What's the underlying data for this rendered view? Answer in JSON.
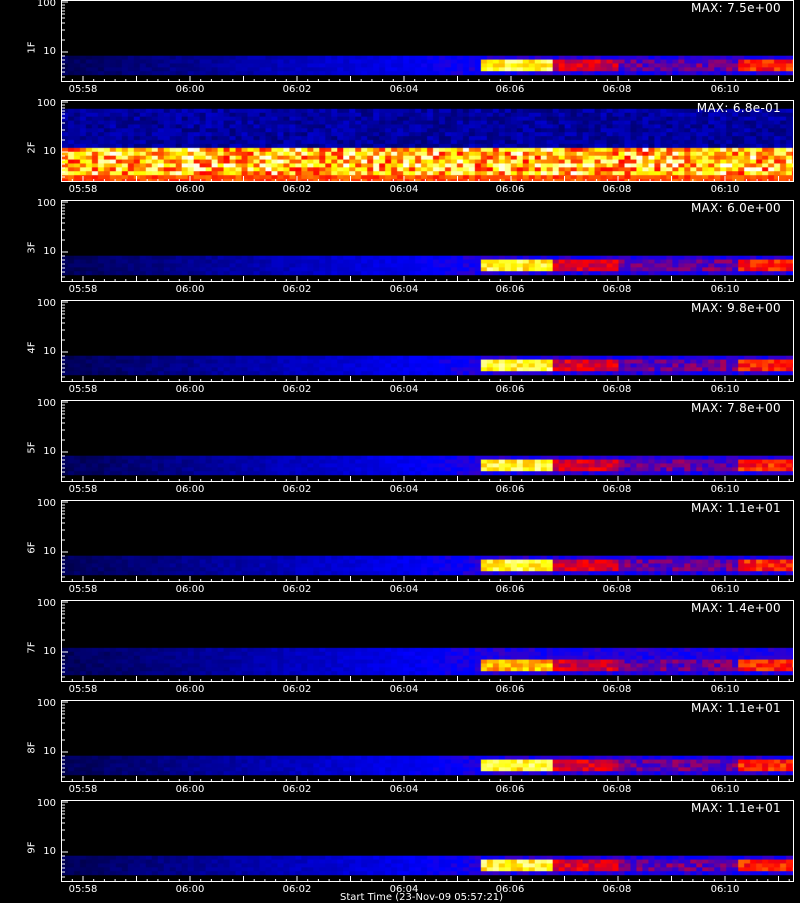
{
  "chart_data": {
    "type": "heatmap",
    "x_ticks": [
      "05:58",
      "06:00",
      "06:02",
      "06:04",
      "06:06",
      "06:08",
      "06:10"
    ],
    "y_ticks": [
      "100",
      "10"
    ],
    "y_scale": "log",
    "panels": [
      {
        "label": "1F",
        "max": "MAX: 7.5e+00",
        "event_strength": 0.95,
        "background": "blue-band"
      },
      {
        "label": "2F",
        "max": "MAX: 6.8e-01",
        "event_strength": 0.6,
        "background": "saturated-yellow-band"
      },
      {
        "label": "3F",
        "max": "MAX: 6.0e+00",
        "event_strength": 0.95,
        "background": "blue-band"
      },
      {
        "label": "4F",
        "max": "MAX: 9.8e+00",
        "event_strength": 0.95,
        "background": "blue-band"
      },
      {
        "label": "5F",
        "max": "MAX: 7.8e+00",
        "event_strength": 0.95,
        "background": "blue-band"
      },
      {
        "label": "6F",
        "max": "MAX: 1.1e+01",
        "event_strength": 0.95,
        "background": "blue-band"
      },
      {
        "label": "7F",
        "max": "MAX: 1.4e+00",
        "event_strength": 0.85,
        "background": "blue-band-wide"
      },
      {
        "label": "8F",
        "max": "MAX: 1.1e+01",
        "event_strength": 0.95,
        "background": "blue-band"
      },
      {
        "label": "9F",
        "max": "MAX: 1.1e+01",
        "event_strength": 0.95,
        "background": "blue-band"
      }
    ],
    "colors": {
      "low": "#0000ff",
      "mid": "#ff0000",
      "high": "#ffff00",
      "peak": "#ffffff",
      "frame": "#ffffff"
    }
  },
  "footer": {
    "text": "Start Time (23-Nov-09 05:57:21)"
  }
}
